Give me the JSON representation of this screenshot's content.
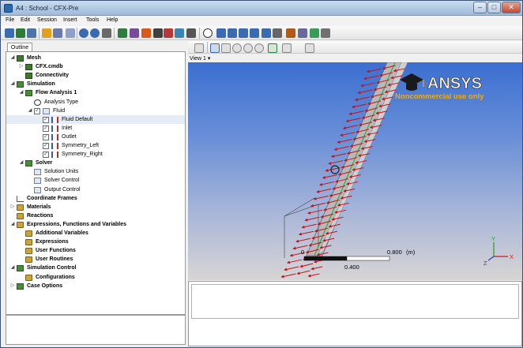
{
  "window": {
    "title": "A4 : School - CFX-Pre"
  },
  "menu": [
    "File",
    "Edit",
    "Session",
    "Insert",
    "Tools",
    "Help"
  ],
  "outline_tab": "Outline",
  "tree": [
    {
      "label": "Mesh",
      "bold": true,
      "level": 0,
      "exp": "◢",
      "icon": "mesh"
    },
    {
      "label": "CFX.cmdb",
      "bold": true,
      "level": 1,
      "exp": "▷",
      "icon": "mesh"
    },
    {
      "label": "Connectivity",
      "bold": true,
      "level": 1,
      "exp": "",
      "icon": "mesh"
    },
    {
      "label": "Simulation",
      "bold": true,
      "level": 0,
      "exp": "◢",
      "icon": "sim"
    },
    {
      "label": "Flow Analysis 1",
      "bold": true,
      "level": 1,
      "exp": "◢",
      "icon": "sim"
    },
    {
      "label": "Analysis Type",
      "bold": false,
      "level": 2,
      "exp": "",
      "icon": "clock"
    },
    {
      "label": "Fluid",
      "bold": false,
      "level": 2,
      "exp": "◢",
      "icon": "plain",
      "check": true
    },
    {
      "label": "Fluid Default",
      "bold": false,
      "level": 3,
      "exp": "",
      "icon": "boundary",
      "check": true,
      "selected": true
    },
    {
      "label": "Inlet",
      "bold": false,
      "level": 3,
      "exp": "",
      "icon": "boundary",
      "check": true
    },
    {
      "label": "Outlet",
      "bold": false,
      "level": 3,
      "exp": "",
      "icon": "boundary",
      "check": true
    },
    {
      "label": "Symmetry_Left",
      "bold": false,
      "level": 3,
      "exp": "",
      "icon": "boundary",
      "check": true
    },
    {
      "label": "Symmetry_Right",
      "bold": false,
      "level": 3,
      "exp": "",
      "icon": "boundary",
      "check": true
    },
    {
      "label": "Solver",
      "bold": true,
      "level": 1,
      "exp": "◢",
      "icon": "sim"
    },
    {
      "label": "Solution Units",
      "bold": false,
      "level": 2,
      "exp": "",
      "icon": "plain"
    },
    {
      "label": "Solver Control",
      "bold": false,
      "level": 2,
      "exp": "",
      "icon": "plain"
    },
    {
      "label": "Output Control",
      "bold": false,
      "level": 2,
      "exp": "",
      "icon": "plain"
    },
    {
      "label": "Coordinate Frames",
      "bold": true,
      "level": 0,
      "exp": "",
      "icon": "axes"
    },
    {
      "label": "Materials",
      "bold": true,
      "level": 0,
      "exp": "▷",
      "icon": "folder"
    },
    {
      "label": "Reactions",
      "bold": true,
      "level": 0,
      "exp": "",
      "icon": "folder"
    },
    {
      "label": "Expressions, Functions and Variables",
      "bold": true,
      "level": 0,
      "exp": "◢",
      "icon": "folder"
    },
    {
      "label": "Additional Variables",
      "bold": true,
      "level": 1,
      "exp": "",
      "icon": "folder"
    },
    {
      "label": "Expressions",
      "bold": true,
      "level": 1,
      "exp": "",
      "icon": "folder"
    },
    {
      "label": "User Functions",
      "bold": true,
      "level": 1,
      "exp": "",
      "icon": "folder"
    },
    {
      "label": "User Routines",
      "bold": true,
      "level": 1,
      "exp": "",
      "icon": "folder"
    },
    {
      "label": "Simulation Control",
      "bold": true,
      "level": 0,
      "exp": "◢",
      "icon": "sim"
    },
    {
      "label": "Configurations",
      "bold": true,
      "level": 1,
      "exp": "",
      "icon": "folder"
    },
    {
      "label": "Case Options",
      "bold": true,
      "level": 0,
      "exp": "▷",
      "icon": "sim"
    }
  ],
  "viewport": {
    "view_label": "View 1",
    "logo_text": "ANSYS",
    "watermark": "Noncommercial use only",
    "scale": {
      "tick0": "0",
      "tick_mid": "0.400",
      "tick_end": "0.800",
      "unit": "(m)"
    },
    "axis": {
      "x": "X",
      "y": "Y",
      "z": "Z"
    }
  },
  "colors": {
    "titlebar": "#b3c9e2",
    "viewport_top": "#3b6fd1",
    "arrows": "#c0141c",
    "mesh": "#9a9a9a",
    "accent": "#f2a90a"
  }
}
